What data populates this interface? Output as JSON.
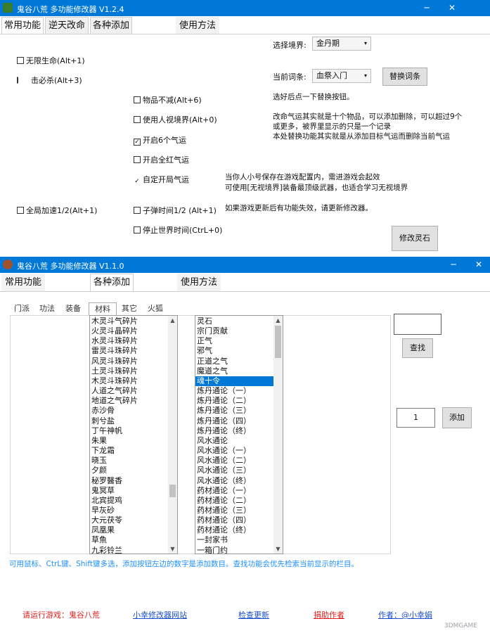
{
  "window1": {
    "title": "鬼谷八荒 多功能修改器  V1.2.4",
    "tabs": [
      "常用功能",
      "逆天改命",
      "各种添加",
      "使用方法"
    ],
    "checkboxes_left": [
      {
        "label": "无限生命(Alt+1)",
        "checked": false
      },
      {
        "label": "击必杀(Alt+3)",
        "checked": false
      },
      {
        "label": "全局加速1/2(Alt+1)",
        "checked": false
      }
    ],
    "checkboxes_mid": [
      {
        "label": "物品不减(Alt+6)",
        "checked": false
      },
      {
        "label": "使用人视境界(Alt+0)",
        "checked": false
      },
      {
        "label": "开启6个气运",
        "checked": true
      },
      {
        "label": "开启全红气运",
        "checked": false
      },
      {
        "label": "自定开局气运",
        "checked": true
      },
      {
        "label": "子弹时间1/2 (Alt+1)",
        "checked": false
      },
      {
        "label": "停止世界时间(CtrL+0)",
        "checked": false
      }
    ],
    "realm_label": "选择境界:",
    "realm_value": "金丹期",
    "entry_label": "当前词条:",
    "entry_value": "血祭入门",
    "replace_button": "替换词条",
    "info_1": "选好后点一下替换按钮。",
    "info_2": [
      "改命气运其实就是十个物品，可以添加删除，可以超过9个",
      "或更多，被界里显示的只是一个记录",
      "本处替换功能其实就是从添加目标气运而删除当前气运"
    ],
    "info_3": [
      "当你人小号保存在游戏配置内，需进游戏会起效",
      "可使用[无视境界]装备最顶级武器，也适合学习无视境界"
    ],
    "info_4": "如果游戏更新后有功能失效，请更新修改器。",
    "modify_button": "修改灵石"
  },
  "window2": {
    "title": "鬼谷八荒 多功能修改器  V1.1.0",
    "tabs": [
      "常用功能",
      "各种添加",
      "使用方法"
    ],
    "subtabs": [
      "门派",
      "功法",
      "装备",
      "材料",
      "其它",
      "火狐"
    ],
    "list1": [
      "木灵斗气碎片",
      "火灵斗晶碎片",
      "水灵斗珠碎片",
      "雷灵斗珠碎片",
      "风灵斗珠碎片",
      "土灵斗珠碎片",
      "木灵斗珠碎片",
      "人道之气碎片",
      "地道之气碎片",
      "赤沙骨",
      "刺兮盐",
      "丁午神帆",
      "朱果",
      "下龙霜",
      "晓玉",
      "夕颜",
      "秘罗醫香",
      "鬼冥草",
      "北宾提鸡",
      "早灰砂",
      "大元茯苓",
      "凤凰果",
      "草魚",
      "九彩铃兰"
    ],
    "list2": [
      "灵石",
      "宗门贡献",
      "正气",
      "邪气",
      "正道之气",
      "魔道之气",
      "魂十令",
      "炼丹通论（一）",
      "炼丹通论（二）",
      "炼丹通论（三）",
      "炼丹通论（四）",
      "炼丹通论（终）",
      "风水通论",
      "风水通论（一）",
      "风水通论（二）",
      "风水通论（三）",
      "风水通论（终）",
      "药材通论（一）",
      "药材通论（二）",
      "药材通论（三）",
      "药材通论（四）",
      "药材通论（终）",
      "一封家书",
      "一箱门约"
    ],
    "list2_selected_index": 6,
    "search_value": "",
    "search_button": "查找",
    "quantity_value": "1",
    "add_button": "添加",
    "hint": "可用鼠标、CtrL键、Shift键多选，添加按钮左边的数字是添加数目。查找功能会优先检索当前显示的栏目。",
    "footer": [
      "请运行游戏：鬼谷八荒",
      "小幸修改器网站",
      "检查更新",
      "捐助作者",
      "作者：@小幸娟"
    ],
    "watermark": "3DMGAME"
  },
  "colors": {
    "titlebar": "#0078d7",
    "selection": "#0078d7",
    "hint_text": "#1e90ff",
    "footer_red": "#e02020",
    "footer_blue": "#1a4fd0"
  }
}
